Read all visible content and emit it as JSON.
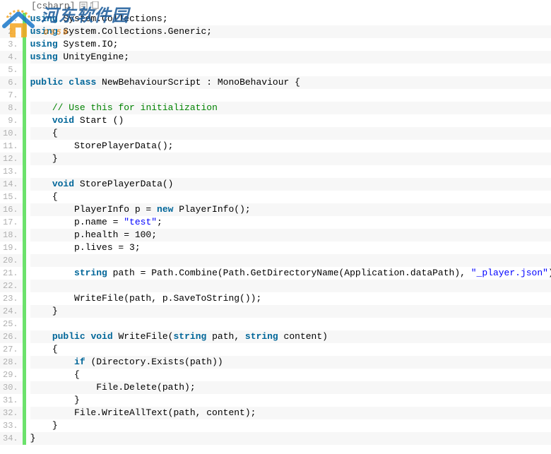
{
  "watermark": {
    "text_cn": "河东软件园",
    "domain": "0359"
  },
  "annotation": {
    "label": "[csharp]",
    "icon1": "view-plain-icon",
    "icon2": "copy-icon"
  },
  "code": {
    "lines": [
      {
        "n": "1.",
        "seg": [
          {
            "c": "ann",
            "t": "[csharp]",
            "toolbar": true
          }
        ]
      },
      {
        "n": " 1.",
        "seg": [
          {
            "c": "kw",
            "t": "using"
          },
          {
            "c": "txt",
            "t": " System.Collections;"
          }
        ]
      },
      {
        "n": " 2.",
        "seg": [
          {
            "c": "kw",
            "t": "using"
          },
          {
            "c": "txt",
            "t": " System.Collections.Generic;"
          }
        ]
      },
      {
        "n": " 3.",
        "seg": [
          {
            "c": "kw",
            "t": "using"
          },
          {
            "c": "txt",
            "t": " System.IO;"
          }
        ]
      },
      {
        "n": " 4.",
        "seg": [
          {
            "c": "kw",
            "t": "using"
          },
          {
            "c": "txt",
            "t": " UnityEngine;"
          }
        ]
      },
      {
        "n": " 5.",
        "seg": [
          {
            "c": "txt",
            "t": ""
          }
        ]
      },
      {
        "n": " 6.",
        "seg": [
          {
            "c": "kw",
            "t": "public"
          },
          {
            "c": "txt",
            "t": " "
          },
          {
            "c": "kw",
            "t": "class"
          },
          {
            "c": "txt",
            "t": " NewBehaviourScript : MonoBehaviour {"
          }
        ]
      },
      {
        "n": " 7.",
        "seg": [
          {
            "c": "txt",
            "t": ""
          }
        ]
      },
      {
        "n": " 8.",
        "seg": [
          {
            "c": "txt",
            "t": "    "
          },
          {
            "c": "com",
            "t": "// Use this for initialization"
          }
        ]
      },
      {
        "n": " 9.",
        "seg": [
          {
            "c": "txt",
            "t": "    "
          },
          {
            "c": "kw",
            "t": "void"
          },
          {
            "c": "txt",
            "t": " Start ()"
          }
        ]
      },
      {
        "n": "10.",
        "seg": [
          {
            "c": "txt",
            "t": "    {"
          }
        ]
      },
      {
        "n": "11.",
        "seg": [
          {
            "c": "txt",
            "t": "        StorePlayerData();"
          }
        ]
      },
      {
        "n": "12.",
        "seg": [
          {
            "c": "txt",
            "t": "    }"
          }
        ]
      },
      {
        "n": "13.",
        "seg": [
          {
            "c": "txt",
            "t": ""
          }
        ]
      },
      {
        "n": "14.",
        "seg": [
          {
            "c": "txt",
            "t": "    "
          },
          {
            "c": "kw",
            "t": "void"
          },
          {
            "c": "txt",
            "t": " StorePlayerData()"
          }
        ]
      },
      {
        "n": "15.",
        "seg": [
          {
            "c": "txt",
            "t": "    {"
          }
        ]
      },
      {
        "n": "16.",
        "seg": [
          {
            "c": "txt",
            "t": "        PlayerInfo p = "
          },
          {
            "c": "kw",
            "t": "new"
          },
          {
            "c": "txt",
            "t": " PlayerInfo();"
          }
        ]
      },
      {
        "n": "17.",
        "seg": [
          {
            "c": "txt",
            "t": "        p.name = "
          },
          {
            "c": "str",
            "t": "\"test\""
          },
          {
            "c": "txt",
            "t": ";"
          }
        ]
      },
      {
        "n": "18.",
        "seg": [
          {
            "c": "txt",
            "t": "        p.health = 100;"
          }
        ]
      },
      {
        "n": "19.",
        "seg": [
          {
            "c": "txt",
            "t": "        p.lives = 3;"
          }
        ]
      },
      {
        "n": "20.",
        "seg": [
          {
            "c": "txt",
            "t": ""
          }
        ]
      },
      {
        "n": "21.",
        "seg": [
          {
            "c": "txt",
            "t": "        "
          },
          {
            "c": "kw",
            "t": "string"
          },
          {
            "c": "txt",
            "t": " path = Path.Combine(Path.GetDirectoryName(Application.dataPath), "
          },
          {
            "c": "str",
            "t": "\"_player.json\""
          },
          {
            "c": "txt",
            "t": ");"
          }
        ]
      },
      {
        "n": "22.",
        "seg": [
          {
            "c": "txt",
            "t": ""
          }
        ]
      },
      {
        "n": "23.",
        "seg": [
          {
            "c": "txt",
            "t": "        WriteFile(path, p.SaveToString());"
          }
        ]
      },
      {
        "n": "24.",
        "seg": [
          {
            "c": "txt",
            "t": "    }"
          }
        ]
      },
      {
        "n": "25.",
        "seg": [
          {
            "c": "txt",
            "t": ""
          }
        ]
      },
      {
        "n": "26.",
        "seg": [
          {
            "c": "txt",
            "t": "    "
          },
          {
            "c": "kw",
            "t": "public"
          },
          {
            "c": "txt",
            "t": " "
          },
          {
            "c": "kw",
            "t": "void"
          },
          {
            "c": "txt",
            "t": " WriteFile("
          },
          {
            "c": "kw",
            "t": "string"
          },
          {
            "c": "txt",
            "t": " path, "
          },
          {
            "c": "kw",
            "t": "string"
          },
          {
            "c": "txt",
            "t": " content)"
          }
        ]
      },
      {
        "n": "27.",
        "seg": [
          {
            "c": "txt",
            "t": "    {"
          }
        ]
      },
      {
        "n": "28.",
        "seg": [
          {
            "c": "txt",
            "t": "        "
          },
          {
            "c": "kw",
            "t": "if"
          },
          {
            "c": "txt",
            "t": " (Directory.Exists(path))"
          }
        ]
      },
      {
        "n": "29.",
        "seg": [
          {
            "c": "txt",
            "t": "        {"
          }
        ]
      },
      {
        "n": "30.",
        "seg": [
          {
            "c": "txt",
            "t": "            File.Delete(path);"
          }
        ]
      },
      {
        "n": "31.",
        "seg": [
          {
            "c": "txt",
            "t": "        }"
          }
        ]
      },
      {
        "n": "32.",
        "seg": [
          {
            "c": "txt",
            "t": "        File.WriteAllText(path, content);"
          }
        ]
      },
      {
        "n": "33.",
        "seg": [
          {
            "c": "txt",
            "t": "    }"
          }
        ]
      },
      {
        "n": "34.",
        "seg": [
          {
            "c": "txt",
            "t": "}"
          }
        ]
      }
    ]
  }
}
